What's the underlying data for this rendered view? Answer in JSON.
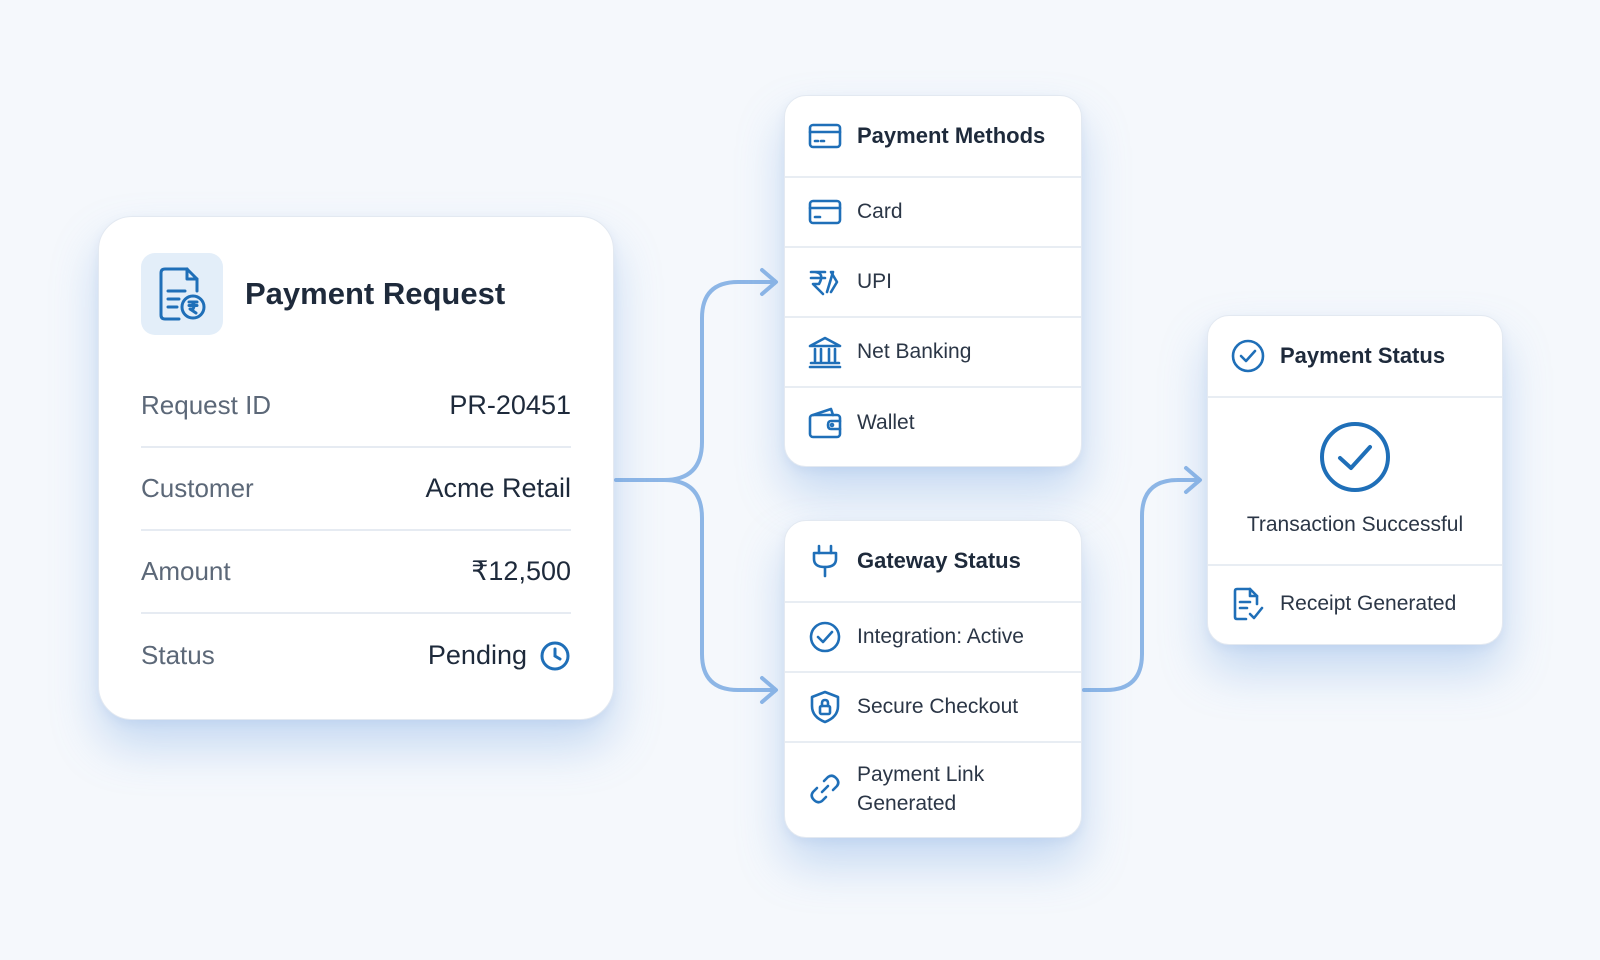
{
  "payment_request": {
    "title": "Payment Request",
    "icon": "receipt-rupee-icon",
    "rows": [
      {
        "label": "Request ID",
        "value": "PR-20451"
      },
      {
        "label": "Customer",
        "value": "Acme Retail"
      },
      {
        "label": "Amount",
        "value": "₹12,500"
      },
      {
        "label": "Status",
        "value": "Pending",
        "icon": "clock-icon"
      }
    ]
  },
  "payment_methods": {
    "title": "Payment Methods",
    "icon": "credit-card-icon",
    "items": [
      {
        "label": "Card",
        "icon": "credit-card-icon"
      },
      {
        "label": "UPI",
        "icon": "upi-icon"
      },
      {
        "label": "Net Banking",
        "icon": "bank-icon"
      },
      {
        "label": "Wallet",
        "icon": "wallet-icon"
      }
    ]
  },
  "gateway_status": {
    "title": "Gateway Status",
    "icon": "plug-icon",
    "items": [
      {
        "label": "Integration: Active",
        "icon": "check-circle-icon"
      },
      {
        "label": "Secure Checkout",
        "icon": "shield-lock-icon"
      },
      {
        "label": "Payment Link Generated",
        "icon": "link-icon"
      }
    ]
  },
  "payment_status": {
    "title": "Payment Status",
    "icon": "check-circle-icon",
    "result": "Transaction Successful",
    "result_icon": "large-check-circle-icon",
    "receipt": "Receipt Generated",
    "receipt_icon": "receipt-check-icon"
  },
  "colors": {
    "accent": "#1f6fb8",
    "connector": "#8db6e6",
    "background": "#f5f8fc",
    "card": "#ffffff",
    "text_primary": "#1e2a3b",
    "text_secondary": "#5c6878"
  }
}
